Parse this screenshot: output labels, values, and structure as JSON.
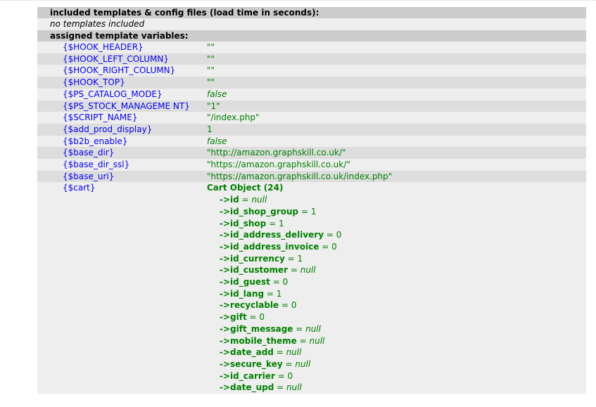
{
  "sections": {
    "included_header": "included templates & config files (load time in seconds):",
    "included_note": "no templates included",
    "assigned_header": "assigned template variables:"
  },
  "variables": [
    {
      "name": "{$HOOK_HEADER}",
      "value": "\"\"",
      "italic": false
    },
    {
      "name": "{$HOOK_LEFT_COLUMN}",
      "value": "\"\"",
      "italic": false
    },
    {
      "name": "{$HOOK_RIGHT_COLUMN}",
      "value": "\"\"",
      "italic": false
    },
    {
      "name": "{$HOOK_TOP}",
      "value": "\"\"",
      "italic": false
    },
    {
      "name": "{$PS_CATALOG_MODE}",
      "value": "false",
      "italic": true
    },
    {
      "name": "{$PS_STOCK_MANAGEME NT}",
      "value": "\"1\"",
      "italic": false
    },
    {
      "name": "{$SCRIPT_NAME}",
      "value": "\"/index.php\"",
      "italic": false
    },
    {
      "name": "{$add_prod_display}",
      "value": "1",
      "italic": false
    },
    {
      "name": "{$b2b_enable}",
      "value": "false",
      "italic": true
    },
    {
      "name": "{$base_dir}",
      "value": "\"http://amazon.graphskill.co.uk/\"",
      "italic": false
    },
    {
      "name": "{$base_dir_ssl}",
      "value": "\"https://amazon.graphskill.co.uk/\"",
      "italic": false
    },
    {
      "name": "{$base_uri}",
      "value": "\"https://amazon.graphskill.co.uk/index.php\"",
      "italic": false
    }
  ],
  "cart": {
    "name": "{$cart}",
    "title": "Cart Object (24)",
    "properties": [
      {
        "prop": "->id",
        "eq": " = ",
        "value": "null",
        "italic": true
      },
      {
        "prop": "->id_shop_group",
        "eq": " = ",
        "value": "1",
        "italic": false
      },
      {
        "prop": "->id_shop",
        "eq": " = ",
        "value": "1",
        "italic": false
      },
      {
        "prop": "->id_address_delivery",
        "eq": " = ",
        "value": "0",
        "italic": false
      },
      {
        "prop": "->id_address_invoice",
        "eq": " = ",
        "value": "0",
        "italic": false
      },
      {
        "prop": "->id_currency",
        "eq": " = ",
        "value": "1",
        "italic": false
      },
      {
        "prop": "->id_customer",
        "eq": " = ",
        "value": "null",
        "italic": true
      },
      {
        "prop": "->id_guest",
        "eq": " = ",
        "value": "0",
        "italic": false
      },
      {
        "prop": "->id_lang",
        "eq": " = ",
        "value": "1",
        "italic": false
      },
      {
        "prop": "->recyclable",
        "eq": " = ",
        "value": "0",
        "italic": false
      },
      {
        "prop": "->gift",
        "eq": " = ",
        "value": "0",
        "italic": false
      },
      {
        "prop": "->gift_message",
        "eq": " = ",
        "value": "null",
        "italic": true
      },
      {
        "prop": "->mobile_theme",
        "eq": " = ",
        "value": "null",
        "italic": true
      },
      {
        "prop": "->date_add",
        "eq": " = ",
        "value": "null",
        "italic": true
      },
      {
        "prop": "->secure_key",
        "eq": " = ",
        "value": "null",
        "italic": true
      },
      {
        "prop": "->id_carrier",
        "eq": " = ",
        "value": "0",
        "italic": false
      },
      {
        "prop": "->date_upd",
        "eq": " = ",
        "value": "null",
        "italic": true
      }
    ]
  },
  "colors": {
    "header_bg": "#cccccc",
    "row_even": "#eeeeee",
    "row_odd": "#dddddd",
    "var_name": "#0000ff",
    "var_value": "#008000"
  }
}
